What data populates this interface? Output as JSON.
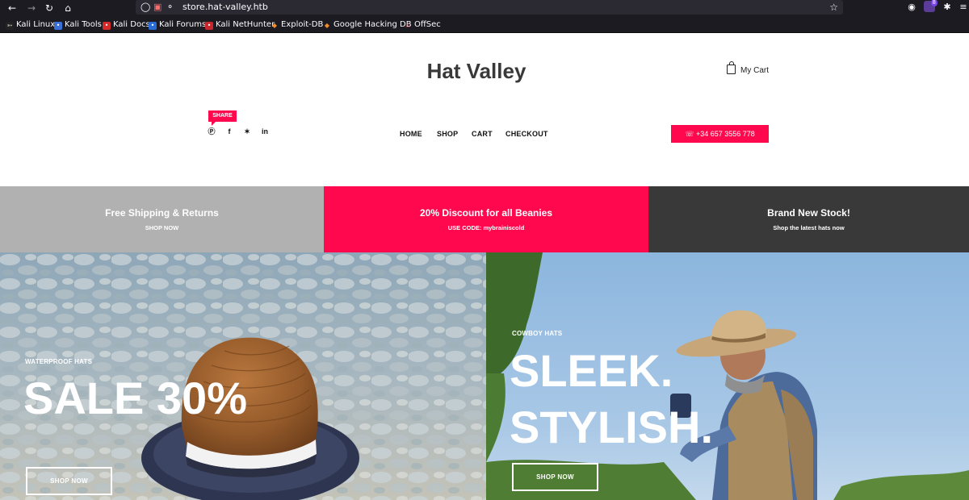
{
  "browser": {
    "url": "store.hat-valley.htb",
    "bookmarks": [
      "Kali Linux",
      "Kali Tools",
      "Kali Docs",
      "Kali Forums",
      "Kali NetHunter",
      "Exploit-DB",
      "Google Hacking DB",
      "OffSec"
    ]
  },
  "header": {
    "brand": "Hat Valley",
    "cart_label": "My Cart",
    "share_label": "SHARE",
    "social": [
      "pinterest-icon",
      "facebook-icon",
      "twitter-icon",
      "linkedin-icon"
    ],
    "nav": [
      "HOME",
      "SHOP",
      "CART",
      "CHECKOUT"
    ],
    "phone": "+34 657 3556 778"
  },
  "promos": [
    {
      "title": "Free Shipping & Returns",
      "subtitle": "SHOP NOW",
      "color": "#b1b1b1"
    },
    {
      "title": "20% Discount for all Beanies",
      "subtitle": "USE CODE: mybrainiscold",
      "color": "#ff084e"
    },
    {
      "title": "Brand New Stock!",
      "subtitle": "Shop the latest hats now",
      "color": "#393939"
    }
  ],
  "heroes": [
    {
      "kicker": "WATERPROOF HATS",
      "headline": "SALE 30%",
      "button": "SHOP NOW"
    },
    {
      "kicker": "COWBOY HATS",
      "headline_line1": "SLEEK.",
      "headline_line2": "STYLISH.",
      "button": "SHOP NOW"
    }
  ],
  "colors": {
    "accent": "#ff084e",
    "dark": "#393939",
    "grey": "#b1b1b1"
  }
}
